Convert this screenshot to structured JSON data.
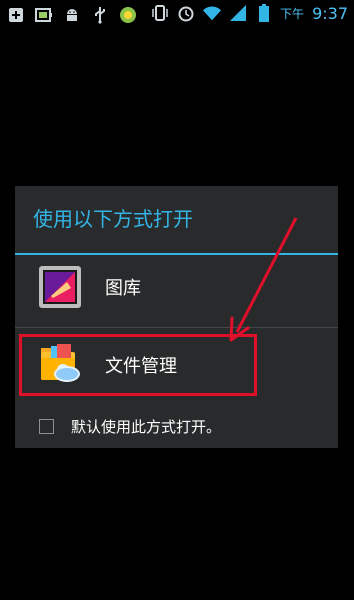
{
  "status_bar": {
    "ampm": "下午",
    "time": "9:37",
    "left_icons": [
      "add-icon",
      "battery-box-icon",
      "android-debug-icon",
      "usb-icon",
      "app-badge-icon"
    ],
    "right_icons": [
      "vibrate-icon",
      "alarm-icon",
      "wifi-icon",
      "signal-icon",
      "battery-icon"
    ]
  },
  "dialog": {
    "title": "使用以下方式打开",
    "options": [
      {
        "label": "图库",
        "icon": "gallery-icon"
      },
      {
        "label": "文件管理",
        "icon": "file-manager-icon"
      }
    ],
    "default_checkbox_label": "默认使用此方式打开。",
    "default_checked": false
  },
  "colors": {
    "accent": "#33b5e5",
    "highlight": "#e0102b",
    "dialog_bg": "#282a2b"
  }
}
